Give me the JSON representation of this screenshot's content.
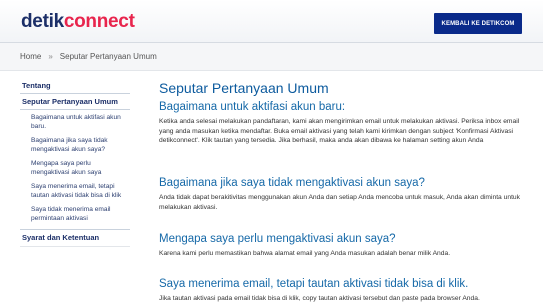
{
  "header": {
    "logo_part1": "detik",
    "logo_part2": "connect",
    "back_button": "KEMBALI KE DETIKCOM"
  },
  "breadcrumb": {
    "home": "Home",
    "separator": "»",
    "current": "Seputar Pertanyaan Umum"
  },
  "sidebar": {
    "tentang": "Tentang",
    "active": "Seputar Pertanyaan Umum",
    "subitems": [
      "Bagaimana untuk aktifasi akun baru.",
      "Bagaimana jika saya tidak mengaktivasi akun saya?",
      "Mengapa saya perlu mengaktivasi akun saya",
      "Saya menerima email, tetapi tautan aktivasi tidak bisa di klik",
      "Saya tidak menerima email permintaan aktivasi"
    ],
    "syarat": "Syarat dan Ketentuan"
  },
  "main": {
    "title": "Seputar Pertanyaan Umum",
    "faqs": [
      {
        "q": "Bagaimana untuk aktifasi akun baru:",
        "a": "Ketika anda selesai melakukan pandaftaran, kami akan mengirimkan email untuk melakukan aktivasi. Periksa inbox email yang anda masukan ketika mendaftar. Buka email aktivasi yang telah kami kirimkan dengan subject 'Konfirmasi Aktivasi detikconnect'. Klik tautan yang tersedia. Jika berhasil, maka anda akan dibawa ke halaman setting akun Anda"
      },
      {
        "q": "Bagaimana jika saya tidak mengaktivasi akun saya?",
        "a": "Anda tidak dapat berakitivitas menggunakan akun Anda dan setiap Anda mencoba untuk masuk, Anda akan diminta untuk melakukan aktivasi."
      },
      {
        "q": "Mengapa saya perlu mengaktivasi akun saya?",
        "a": "Karena kami perlu memastikan bahwa alamat email yang Anda masukan adalah benar milik Anda."
      },
      {
        "q": "Saya menerima email, tetapi tautan aktivasi tidak bisa di klik.",
        "a": "Jika tautan aktivasi pada email tidak bisa di klik, copy tautan aktivasi tersebut dan paste pada browser Anda."
      }
    ]
  },
  "colors": {
    "brand_dark": "#1c2f68",
    "brand_accent": "#e8254d",
    "button_bg": "#0a2a8a",
    "heading": "#1669a8"
  }
}
